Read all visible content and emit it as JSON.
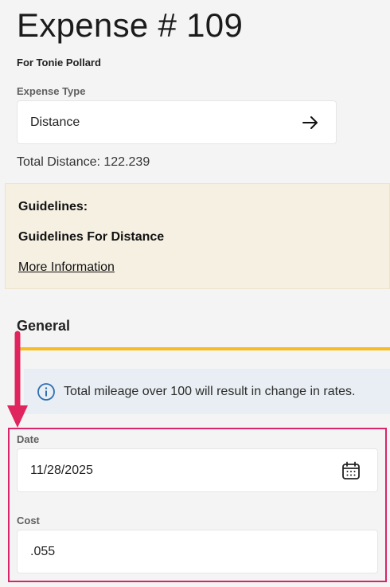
{
  "header": {
    "title": "Expense # 109",
    "subtitle": "For Tonie Pollard"
  },
  "expense_type": {
    "label": "Expense Type",
    "value": "Distance",
    "icon": "arrow-right-icon"
  },
  "total_distance": "Total Distance: 122.239",
  "guidelines": {
    "title": "Guidelines:",
    "subtitle": "Guidelines For Distance",
    "link": "More Information",
    "bg_color": "#f6f0e3"
  },
  "general": {
    "title": "General",
    "accent_color": "#f5bd23",
    "info_message": "Total mileage over 100 will result in change in rates.",
    "info_icon": "info-icon"
  },
  "fields": {
    "date_label": "Date",
    "date_value": "11/28/2025",
    "date_icon": "calendar-icon",
    "cost_label": "Cost",
    "cost_value": ".055"
  },
  "annotation": {
    "highlight_color": "#d8246a",
    "arrow_icon": "arrow-down-icon"
  }
}
